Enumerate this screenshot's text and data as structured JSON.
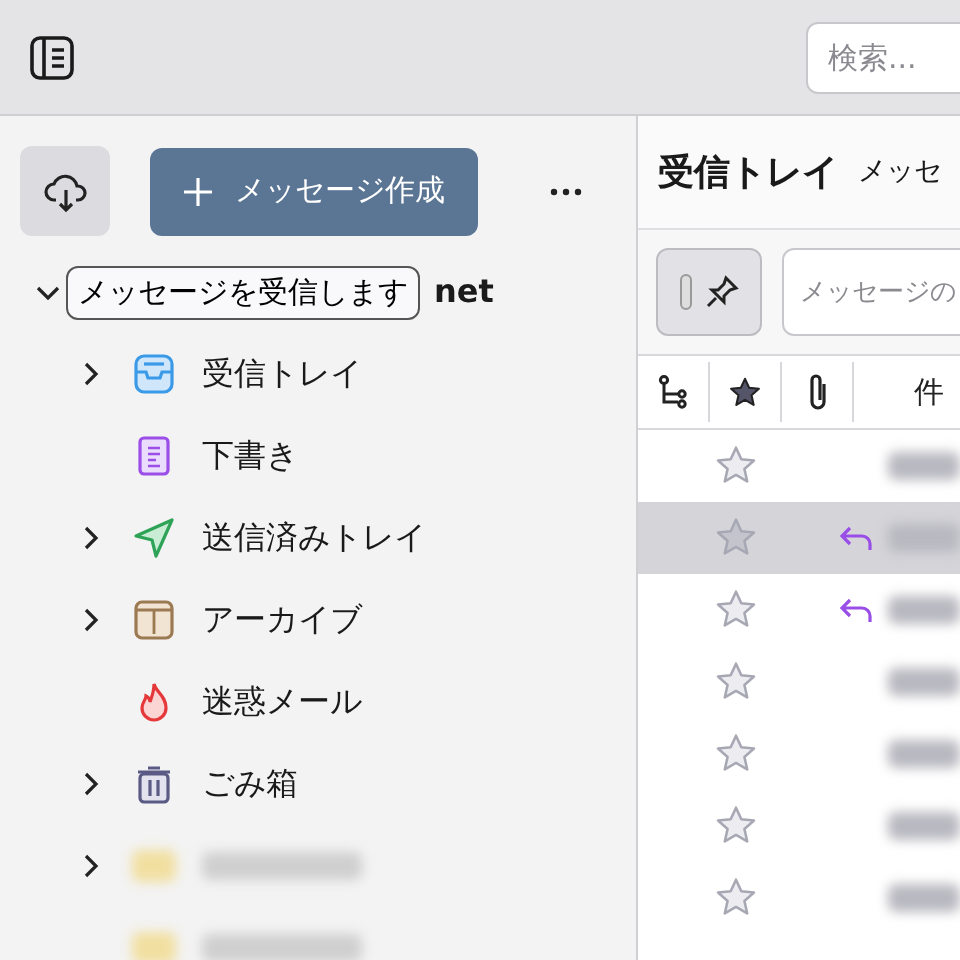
{
  "toolbar": {
    "search": {
      "placeholder": "検索..."
    }
  },
  "folder_pane": {
    "compose_button": "メッセージ作成",
    "tooltip": "メッセージを受信します",
    "account": {
      "name": "net",
      "expanded": true
    },
    "folders": [
      {
        "kind": "inbox",
        "name": "受信トレイ",
        "expandable": true
      },
      {
        "kind": "drafts",
        "name": "下書き",
        "expandable": false
      },
      {
        "kind": "sent",
        "name": "送信済みトレイ",
        "expandable": true
      },
      {
        "kind": "archive",
        "name": "アーカイブ",
        "expandable": true
      },
      {
        "kind": "junk",
        "name": "迷惑メール",
        "expandable": false
      },
      {
        "kind": "trash",
        "name": "ごみ箱",
        "expandable": true
      },
      {
        "kind": "redacted",
        "expandable": true
      },
      {
        "kind": "redacted",
        "expandable": false
      }
    ]
  },
  "message_pane": {
    "title": "受信トレイ",
    "count_label": "メッセ",
    "quick_filter": {
      "placeholder": "メッセージの"
    },
    "columns": [
      {
        "kind": "thread"
      },
      {
        "kind": "star"
      },
      {
        "kind": "attachment"
      },
      {
        "kind": "text",
        "label": "件"
      }
    ],
    "rows": [
      {
        "selected": false,
        "starred": false,
        "replied": false
      },
      {
        "selected": true,
        "starred": false,
        "replied": true
      },
      {
        "selected": false,
        "starred": false,
        "replied": true
      },
      {
        "selected": false,
        "starred": false,
        "replied": false
      },
      {
        "selected": false,
        "starred": false,
        "replied": false
      },
      {
        "selected": false,
        "starred": false,
        "replied": false
      },
      {
        "selected": false,
        "starred": false,
        "replied": false
      }
    ]
  }
}
